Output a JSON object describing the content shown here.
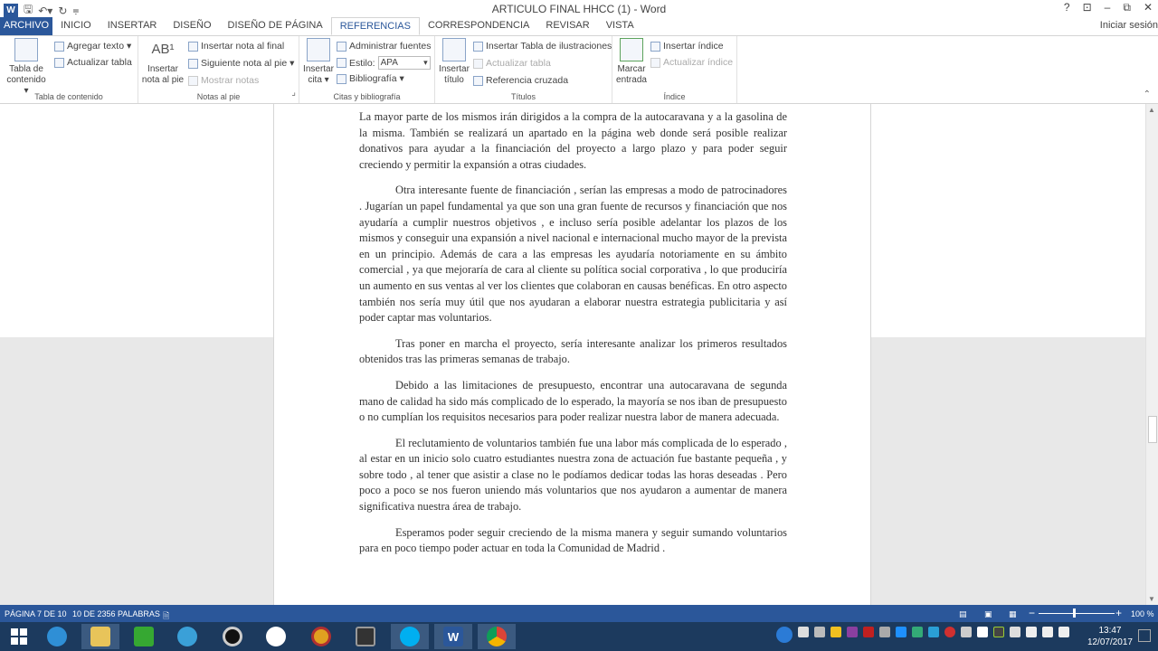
{
  "window": {
    "title": "ARTICULO FINAL HHCC (1) - Word",
    "help": "?",
    "minimize": "–",
    "restore": "⧉",
    "close": "✕"
  },
  "tabs": [
    "ARCHIVO",
    "INICIO",
    "INSERTAR",
    "DISEÑO",
    "DISEÑO DE PÁGINA",
    "REFERENCIAS",
    "CORRESPONDENCIA",
    "REVISAR",
    "VISTA"
  ],
  "active_tab": "REFERENCIAS",
  "signin": "Iniciar sesión",
  "ribbon": {
    "toc": {
      "label": "Tabla de contenido",
      "big_line1": "Tabla de",
      "big_line2": "contenido ▾",
      "add_text": "Agregar texto ▾",
      "update_table": "Actualizar tabla"
    },
    "footnotes": {
      "label": "Notas al pie",
      "insert_footnote_line1": "Insertar",
      "insert_footnote_line2": "nota al pie",
      "insert_endnote": "Insertar nota al final",
      "next_footnote": "Siguiente nota al pie ▾",
      "show_notes": "Mostrar notas"
    },
    "citations": {
      "label": "Citas y bibliografía",
      "insert_citation_line1": "Insertar",
      "insert_citation_line2": "cita ▾",
      "manage_sources": "Administrar fuentes",
      "style_label": "Estilo:",
      "style_value": "APA",
      "bibliography": "Bibliografía ▾"
    },
    "captions": {
      "label": "Títulos",
      "insert_caption_line1": "Insertar",
      "insert_caption_line2": "título",
      "insert_table_figures": "Insertar Tabla de ilustraciones",
      "update_table": "Actualizar tabla",
      "cross_reference": "Referencia cruzada"
    },
    "index": {
      "label": "Índice",
      "mark_entry_line1": "Marcar",
      "mark_entry_line2": "entrada",
      "insert_index": "Insertar índice",
      "update_index": "Actualizar índice"
    }
  },
  "document": {
    "paragraphs": [
      "La mayor parte de los mismos irán dirigidos a la compra de la autocaravana y a la gasolina de la misma. También se realizará un apartado en la página web donde será posible realizar donativos para ayudar a la financiación del proyecto a largo plazo y para poder seguir creciendo y permitir la expansión a otras ciudades.",
      "Otra interesante fuente de financiación , serían las empresas a modo de patrocinadores . Jugarían un papel fundamental ya que son una gran fuente de recursos y financiación que nos ayudaría a cumplir nuestros objetivos , e incluso sería posible adelantar los plazos de los mismos y conseguir una expansión a nivel nacional e internacional mucho mayor de la prevista en un principio. Además de cara a las empresas les ayudaría notoriamente en su ámbito comercial , ya que mejoraría de cara al cliente su política social corporativa , lo que produciría un aumento en sus ventas al ver los clientes que colaboran en causas benéficas. En otro aspecto también nos sería muy útil que nos ayudaran a elaborar nuestra estrategia publicitaria y así poder captar mas voluntarios.",
      "Tras poner en marcha el proyecto, sería interesante analizar los primeros resultados obtenidos tras las primeras semanas de trabajo.",
      "Debido a las limitaciones de presupuesto, encontrar una autocaravana de segunda mano de calidad ha sido más complicado de lo esperado, la mayoría se nos iban de presupuesto o no cumplían los requisitos necesarios para poder realizar nuestra labor de manera adecuada.",
      "El reclutamiento de voluntarios también fue una labor más complicada de lo esperado , al estar en un inicio solo cuatro estudiantes nuestra zona de actuación fue bastante pequeña , y sobre todo , al tener que asistir a clase no le podíamos dedicar todas las horas deseadas . Pero poco a poco se nos fueron uniendo más voluntarios que nos ayudaron a aumentar de manera significativa nuestra área de trabajo.",
      "Esperamos poder seguir creciendo de la misma manera y seguir sumando voluntarios para en poco tiempo poder actuar en toda la Comunidad de Madrid ."
    ]
  },
  "status": {
    "page": "PÁGINA 7 DE 10",
    "words": "10 DE 2356 PALABRAS",
    "zoom_minus": "−",
    "zoom_plus": "+",
    "zoom": "100 %"
  },
  "taskbar": {
    "time": "13:47",
    "date": "12/07/2017"
  },
  "colors": {
    "word_blue": "#2b579a",
    "taskbar": "#1c3a5e"
  }
}
